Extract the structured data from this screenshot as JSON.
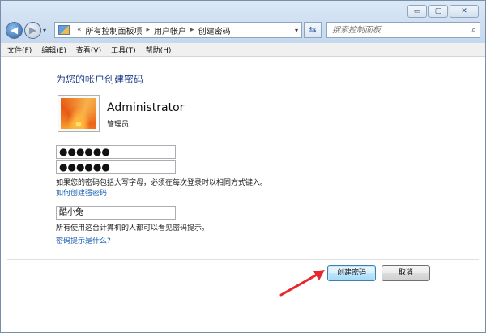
{
  "window": {
    "caption_buttons": {
      "minimize": "▭",
      "maximize": "▢",
      "close": "✕"
    }
  },
  "nav": {
    "back_glyph": "◀",
    "forward_glyph": "▶",
    "history_glyph": "▾",
    "breadcrumbs": [
      "所有控制面板项",
      "用户帐户",
      "创建密码"
    ],
    "breadcrumb_prefix": "«",
    "breadcrumb_separator": "▸",
    "address_dropdown_glyph": "▾",
    "refresh_glyph": "⇆",
    "search_placeholder": "搜索控制面板",
    "search_glyph": "⌕"
  },
  "menu": {
    "items": [
      "文件(F)",
      "编辑(E)",
      "查看(V)",
      "工具(T)",
      "帮助(H)"
    ]
  },
  "content": {
    "heading": "为您的帐户创建密码",
    "user": {
      "name": "Administrator",
      "role": "管理员"
    },
    "new_password_value": "●●●●●●",
    "confirm_password_value": "●●●●●●",
    "case_note": "如果您的密码包括大写字母，必须在每次登录时以相同方式键入。",
    "strong_password_link": "如何创建强密码",
    "hint_value": "酷小兔",
    "hint_note": "所有使用这台计算机的人都可以看见密码提示。",
    "hint_link": "密码提示是什么?"
  },
  "actions": {
    "create_label": "创建密码",
    "cancel_label": "取消"
  },
  "colors": {
    "heading": "#1e3f8a",
    "link": "#1a5fb4",
    "arrow": "#e8262b"
  }
}
